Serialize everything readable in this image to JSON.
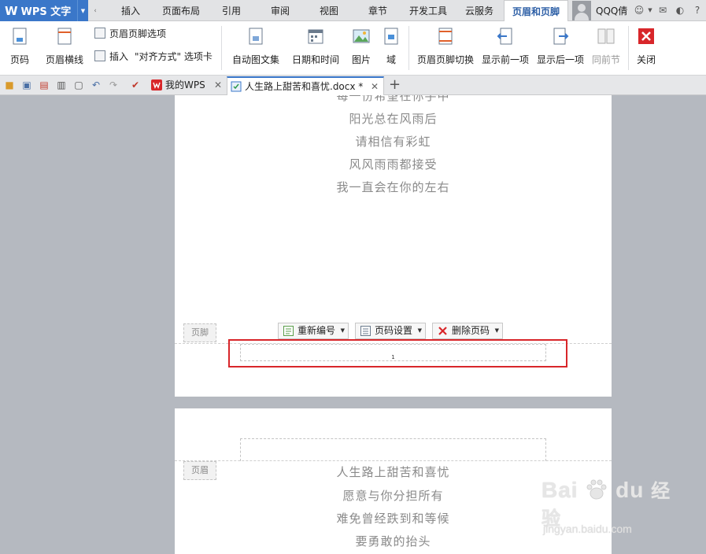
{
  "app": {
    "logo_mark": "W",
    "name": "WPS 文字",
    "menu_tabs": [
      "插入",
      "页面布局",
      "引用",
      "审阅",
      "视图",
      "章节",
      "开发工具",
      "云服务",
      "页眉和页脚"
    ],
    "active_tab_index": 8,
    "user": "QQQ倩"
  },
  "ribbon": {
    "page_number": "页码",
    "header_line": "页眉横线",
    "header_footer_options": "页眉页脚选项",
    "insert": "插入",
    "align_tab": "\"对齐方式\" 选项卡",
    "auto_text": "自动图文集",
    "date_time": "日期和时间",
    "picture": "图片",
    "field": "域",
    "switch_header_footer": "页眉页脚切换",
    "show_prev": "显示前一项",
    "show_next": "显示后一项",
    "same_as_prev": "同前节",
    "close": "关闭"
  },
  "doc_tabs": [
    {
      "label": "我的WPS"
    },
    {
      "label": "人生路上甜苦和喜忧.docx *"
    }
  ],
  "page1": {
    "partial_line": "每一份希望在你手中",
    "lines": [
      "阳光总在风雨后",
      "请相信有彩虹",
      "风风雨雨都接受",
      "我一直会在你的左右"
    ],
    "footer_label": "页脚",
    "page_number_value": "1"
  },
  "footer_toolbar": {
    "renumber": "重新编号",
    "page_settings": "页码设置",
    "delete_page_number": "删除页码"
  },
  "page2": {
    "header_label": "页眉",
    "lines": [
      "人生路上甜苦和喜忧",
      "愿意与你分担所有",
      "难免曾经跌到和等候",
      "要勇敢的抬头"
    ]
  },
  "watermark": {
    "brand": "Bai",
    "brand2": "du",
    "product": "经验",
    "url": "jingyan.baidu.com"
  },
  "colors": {
    "accent": "#3a77c9",
    "highlight": "#d8262a",
    "doc_text": "#8a8a8a"
  }
}
